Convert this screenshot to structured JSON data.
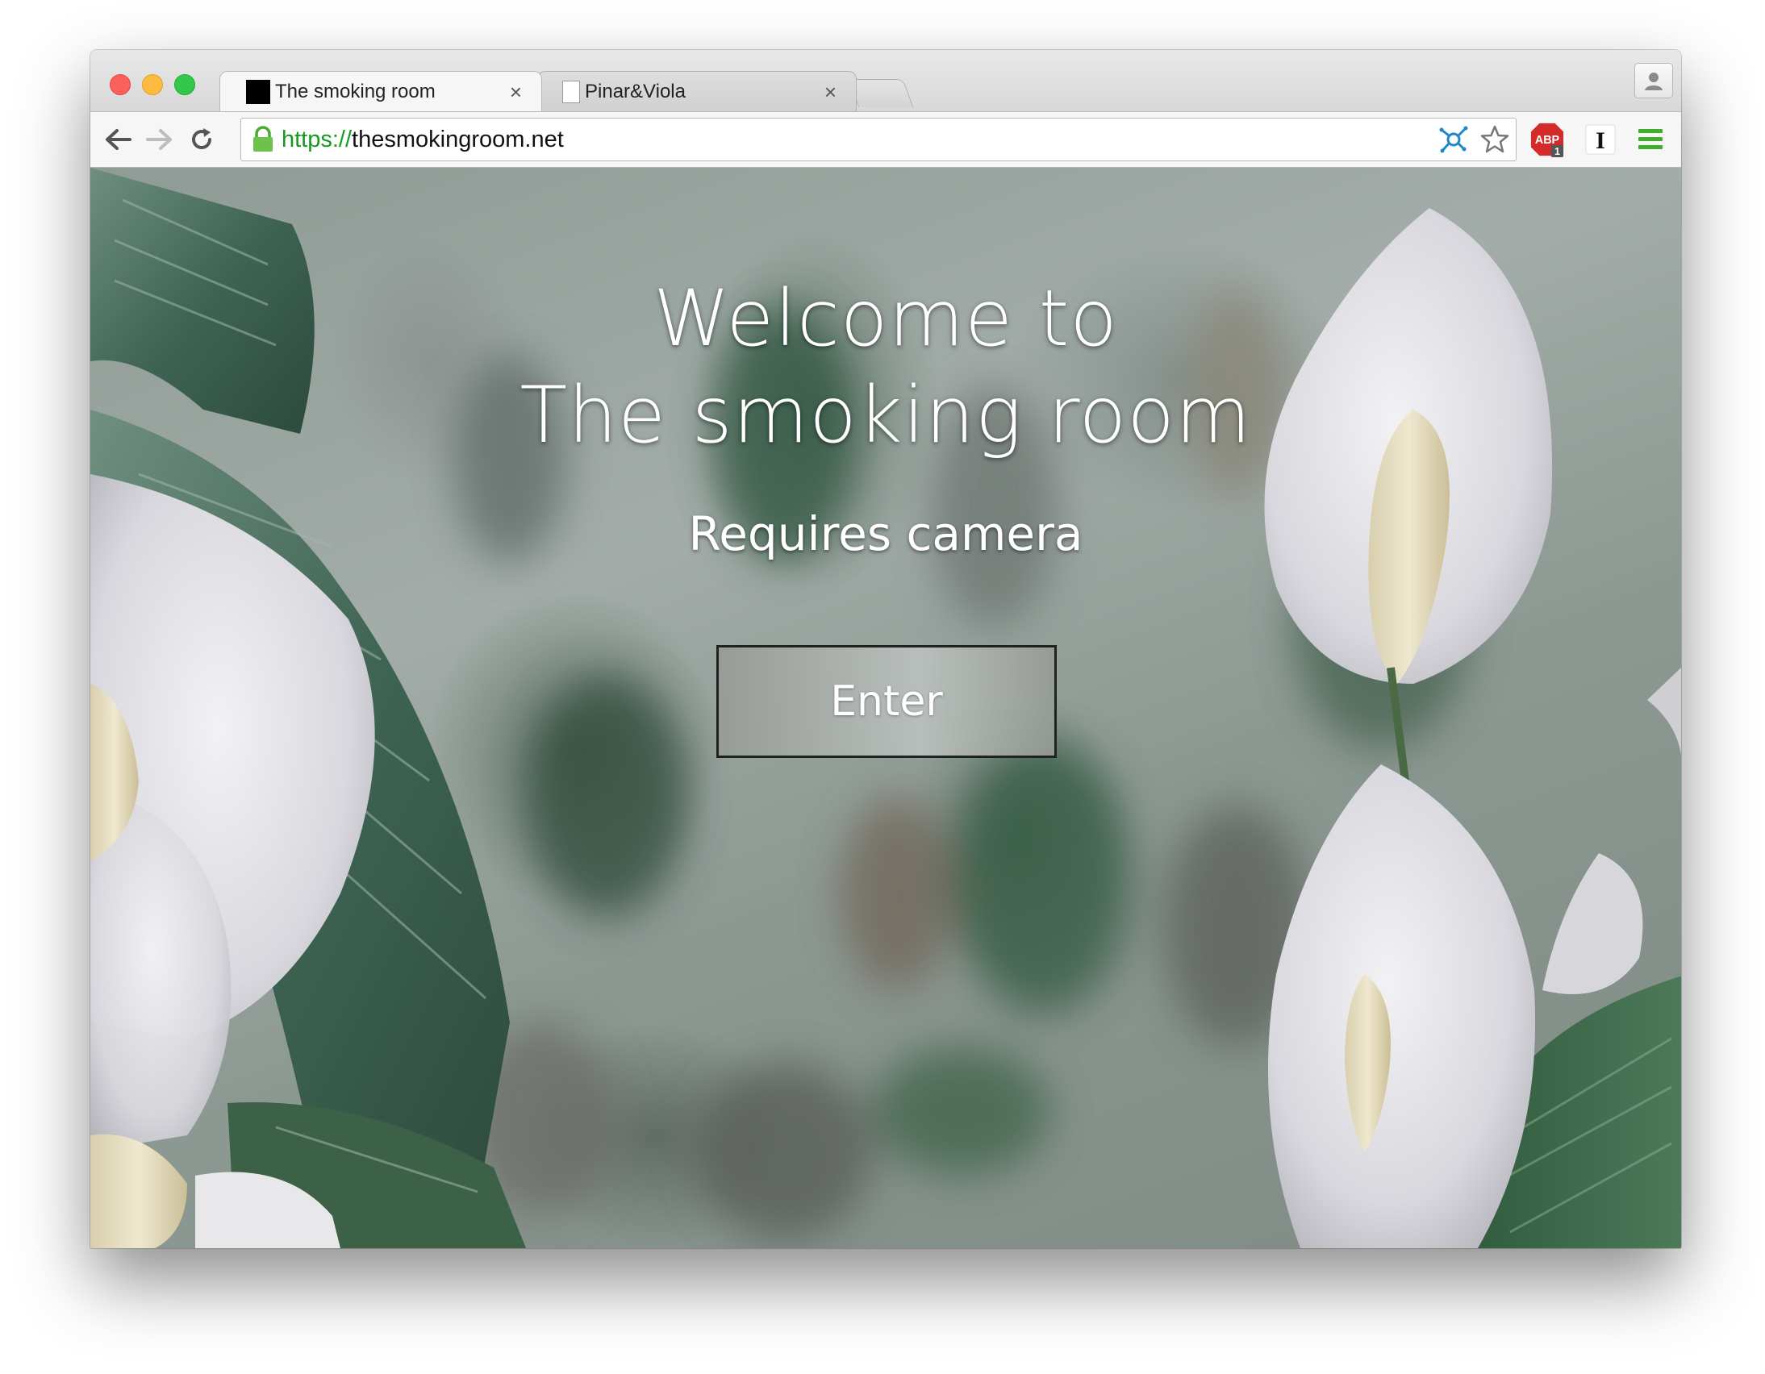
{
  "browser": {
    "tabs": [
      {
        "title": "The smoking room",
        "active": true,
        "favicon": "black-square-favicon"
      },
      {
        "title": "Pinar&Viola",
        "active": false,
        "favicon": "document-favicon"
      }
    ],
    "tab_close_glyph": "×",
    "address": {
      "scheme": "https://",
      "host": "thesmokingroom.net"
    },
    "colors": {
      "secure_green": "#159a1f",
      "abp_red": "#d32a2a",
      "menu_green": "#3fae2a"
    },
    "extensions": {
      "abp_label": "ABP",
      "abp_count": "1",
      "instapaper_label": "I"
    }
  },
  "page": {
    "headline_line1": "Welcome to",
    "headline_line2": "The smoking room",
    "subhead": "Requires camera",
    "enter_label": "Enter"
  }
}
